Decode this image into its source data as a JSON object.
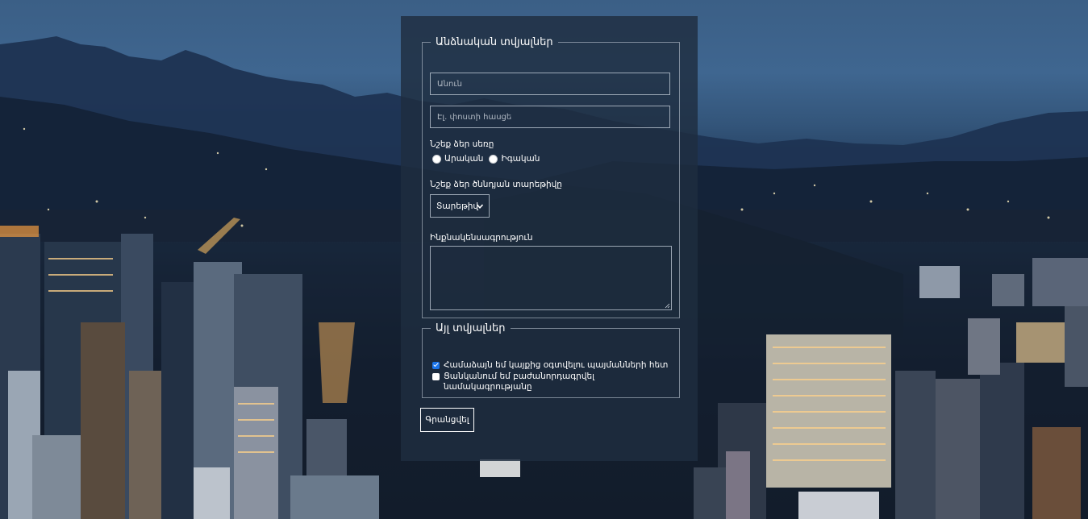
{
  "form": {
    "personal": {
      "legend": "Անձնական տվյալներ",
      "name_placeholder": "Անուն",
      "email_placeholder": "Էլ. փոստի հասցե",
      "gender_label": "Նշեք ձեր սեռը",
      "gender_options": [
        "Արական",
        "Իգական"
      ],
      "birth_year_label": "Նշեք ձեր ծննդյան տարեթիվը",
      "birth_year_selected": "Տարեթիվ",
      "bio_label": "Ինքնակենսագրություն"
    },
    "other": {
      "legend": "Այլ տվյալներ",
      "agree_terms": {
        "label": "Համաձայն եմ կայքից օգտվելու պայմանների հետ",
        "checked": true
      },
      "newsletter": {
        "label": "Ցանկանում եմ բաժանորդագրվել նամակագրությանը",
        "checked": false
      }
    },
    "submit_label": "Գրանցվել"
  },
  "icons": {
    "select_chevron": "chevron-down-icon",
    "resize": "resize-handle-icon"
  }
}
